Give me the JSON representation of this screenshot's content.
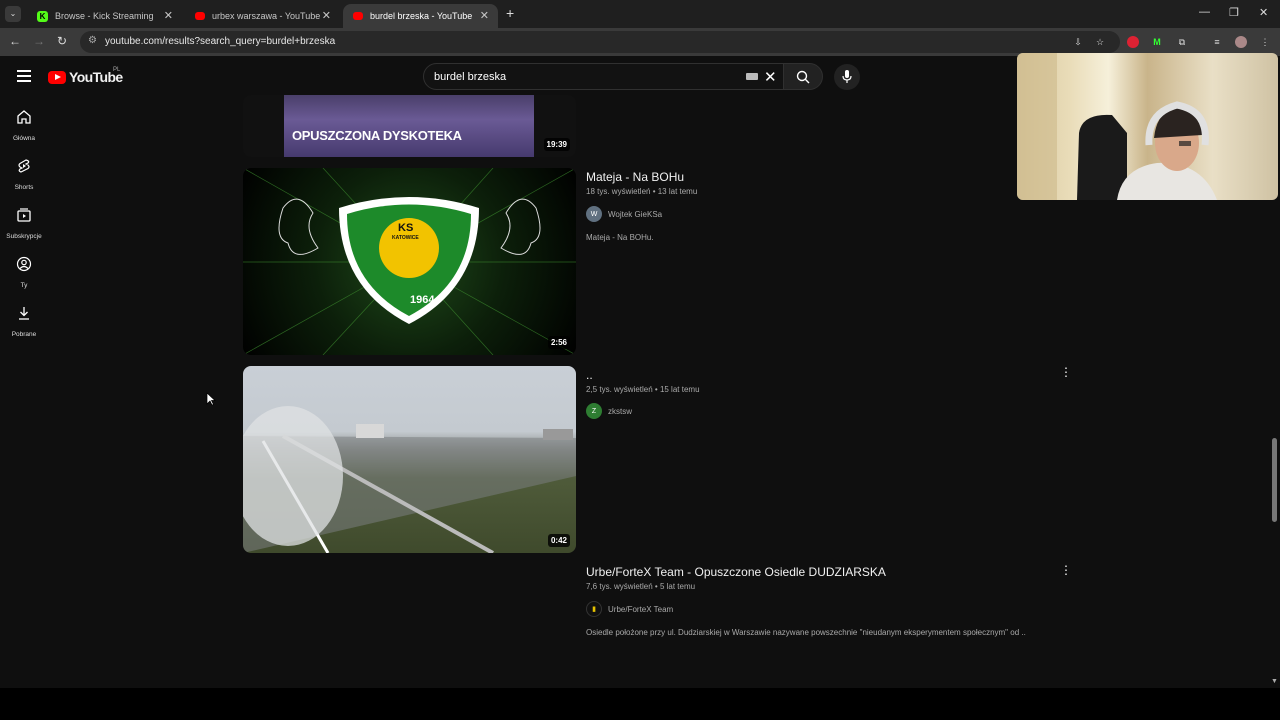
{
  "browser": {
    "tabs": [
      {
        "label": "Browse - Kick Streaming",
        "icon": "kick-icon",
        "active": false
      },
      {
        "label": "urbex warszawa - YouTube",
        "icon": "youtube-icon",
        "active": false
      },
      {
        "label": "burdel brzeska - YouTube",
        "icon": "youtube-icon",
        "active": true
      }
    ],
    "url": "youtube.com/results?search_query=burdel+brzeska"
  },
  "youtube": {
    "logo_text": "YouTube",
    "country_code": "PL",
    "search_query": "burdel brzeska",
    "sidebar": [
      {
        "label": "Główna",
        "icon": "home-icon"
      },
      {
        "label": "Shorts",
        "icon": "shorts-icon"
      },
      {
        "label": "Subskrypcje",
        "icon": "subscriptions-icon"
      },
      {
        "label": "Ty",
        "icon": "you-icon"
      },
      {
        "label": "Pobrane",
        "icon": "downloads-icon"
      }
    ],
    "results": [
      {
        "thumb_text": "OPUSZCZONA DYSKOTEKA",
        "duration": "19:39"
      },
      {
        "title": "Mateja - Na BOHu",
        "meta": "18 tys. wyświetleń • 13 lat temu",
        "channel": "Wojtek GieKSa",
        "avatar_letter": "W",
        "description": "Mateja - Na BOHu.",
        "duration": "2:56",
        "badge_top": "KS",
        "badge_mid": "KATOWICE",
        "badge_year": "1964"
      },
      {
        "title": "..",
        "meta": "2,5 tys. wyświetleń • 15 lat temu",
        "channel": "zkstsw",
        "avatar_letter": "Z",
        "duration": "0:42"
      },
      {
        "title": "Urbe/ForteX Team - Opuszczone Osiedle DUDZIARSKA",
        "meta": "7,6 tys. wyświetleń • 5 lat temu",
        "channel": "Urbe/ForteX Team",
        "description": "Osiedle położone przy ul. Dudziarskiej w Warszawie nazywane powszechnie \"nieudanym eksperymentem społecznym\" od ..."
      }
    ]
  }
}
